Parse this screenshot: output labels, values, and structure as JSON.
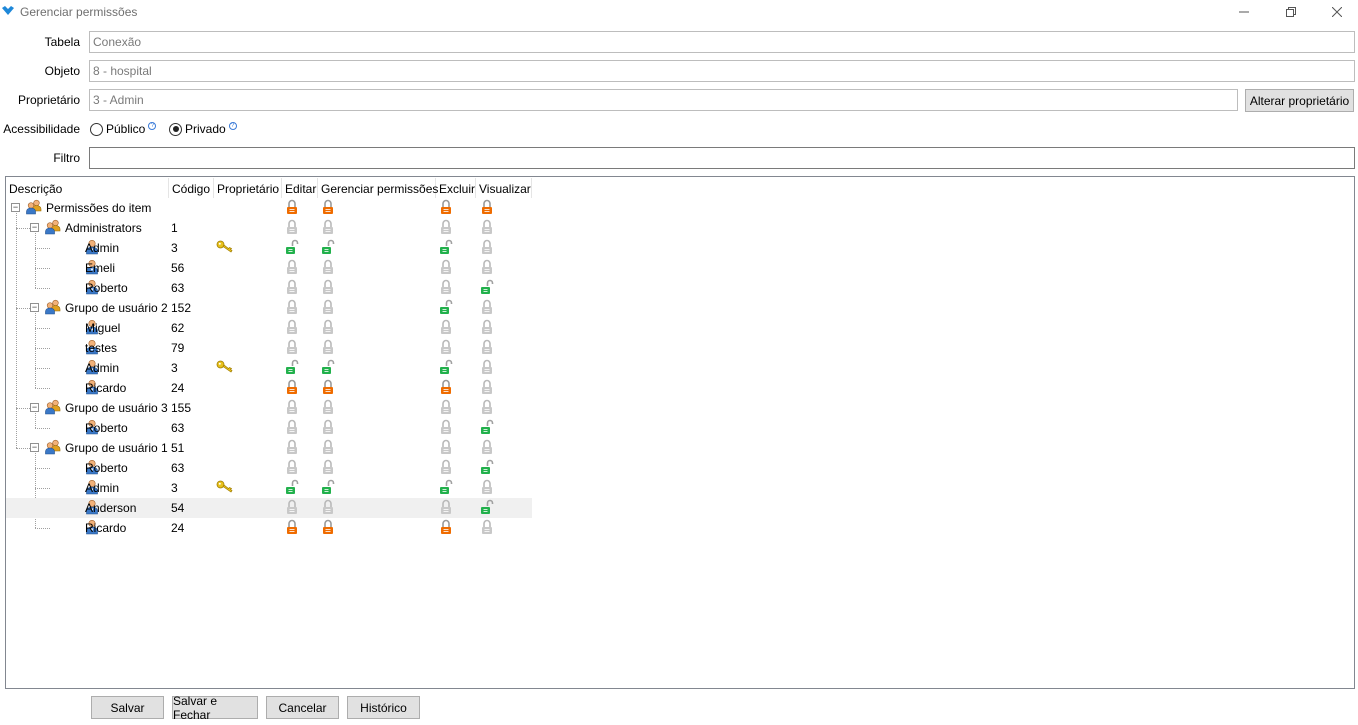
{
  "window": {
    "title": "Gerenciar permissões"
  },
  "form": {
    "tabela_label": "Tabela",
    "tabela_value": "Conexão",
    "objeto_label": "Objeto",
    "objeto_value": "8 - hospital",
    "proprietario_label": "Proprietário",
    "proprietario_value": "3 - Admin",
    "alterar_button": "Alterar proprietário",
    "acessibilidade_label": "Acessibilidade",
    "publico_label": "Público",
    "privado_label": "Privado",
    "selected_access": "Privado",
    "filtro_label": "Filtro",
    "filtro_value": ""
  },
  "columns": [
    "Descrição",
    "Código",
    "Proprietário",
    "Editar",
    "Gerenciar permissões",
    "Excluir",
    "Visualizar"
  ],
  "rows": [
    {
      "level": 0,
      "type": "group",
      "name": "Permissões do item",
      "code": "",
      "owner": false,
      "editar": "orange",
      "gerenciar": "orange",
      "excluir": "orange",
      "visualizar": "orange",
      "expanded": true
    },
    {
      "level": 1,
      "type": "group",
      "name": "Administrators",
      "code": "1",
      "owner": false,
      "editar": "gray",
      "gerenciar": "gray",
      "excluir": "gray",
      "visualizar": "gray",
      "expanded": true
    },
    {
      "level": 2,
      "type": "user",
      "name": "Admin",
      "code": "3",
      "owner": true,
      "editar": "green",
      "gerenciar": "green",
      "excluir": "green",
      "visualizar": "gray"
    },
    {
      "level": 2,
      "type": "user",
      "name": "Emeli",
      "code": "56",
      "owner": false,
      "editar": "gray",
      "gerenciar": "gray",
      "excluir": "gray",
      "visualizar": "gray"
    },
    {
      "level": 2,
      "type": "user",
      "name": "Roberto",
      "code": "63",
      "owner": false,
      "editar": "gray",
      "gerenciar": "gray",
      "excluir": "gray",
      "visualizar": "green"
    },
    {
      "level": 1,
      "type": "group",
      "name": "Grupo de usuário 2",
      "code": "152",
      "owner": false,
      "editar": "gray",
      "gerenciar": "gray",
      "excluir": "green",
      "visualizar": "gray",
      "expanded": true
    },
    {
      "level": 2,
      "type": "user",
      "name": "Miguel",
      "code": "62",
      "owner": false,
      "editar": "gray",
      "gerenciar": "gray",
      "excluir": "gray",
      "visualizar": "gray"
    },
    {
      "level": 2,
      "type": "user",
      "name": "testes",
      "code": "79",
      "owner": false,
      "editar": "gray",
      "gerenciar": "gray",
      "excluir": "gray",
      "visualizar": "gray"
    },
    {
      "level": 2,
      "type": "user",
      "name": "Admin",
      "code": "3",
      "owner": true,
      "editar": "green",
      "gerenciar": "green",
      "excluir": "green",
      "visualizar": "gray"
    },
    {
      "level": 2,
      "type": "user",
      "name": "Ricardo",
      "code": "24",
      "owner": false,
      "editar": "orange",
      "gerenciar": "orange",
      "excluir": "orange",
      "visualizar": "gray"
    },
    {
      "level": 1,
      "type": "group",
      "name": "Grupo de usuário 3",
      "code": "155",
      "owner": false,
      "editar": "gray",
      "gerenciar": "gray",
      "excluir": "gray",
      "visualizar": "gray",
      "expanded": true
    },
    {
      "level": 2,
      "type": "user",
      "name": "Roberto",
      "code": "63",
      "owner": false,
      "editar": "gray",
      "gerenciar": "gray",
      "excluir": "gray",
      "visualizar": "green"
    },
    {
      "level": 1,
      "type": "group",
      "name": "Grupo de usuário 1",
      "code": "51",
      "owner": false,
      "editar": "gray",
      "gerenciar": "gray",
      "excluir": "gray",
      "visualizar": "gray",
      "expanded": true
    },
    {
      "level": 2,
      "type": "user",
      "name": "Roberto",
      "code": "63",
      "owner": false,
      "editar": "gray",
      "gerenciar": "gray",
      "excluir": "gray",
      "visualizar": "green"
    },
    {
      "level": 2,
      "type": "user",
      "name": "Admin",
      "code": "3",
      "owner": true,
      "editar": "green",
      "gerenciar": "green",
      "excluir": "green",
      "visualizar": "gray"
    },
    {
      "level": 2,
      "type": "user",
      "name": "Anderson",
      "code": "54",
      "owner": false,
      "editar": "gray",
      "gerenciar": "gray",
      "excluir": "gray",
      "visualizar": "green",
      "selected": true
    },
    {
      "level": 2,
      "type": "user",
      "name": "Ricardo",
      "code": "24",
      "owner": false,
      "editar": "orange",
      "gerenciar": "orange",
      "excluir": "orange",
      "visualizar": "gray"
    }
  ],
  "buttons": {
    "salvar": "Salvar",
    "salvar_fechar": "Salvar e Fechar",
    "cancelar": "Cancelar",
    "historico": "Histórico"
  },
  "colors": {
    "lock_gray": "#c8c8c8",
    "lock_green": "#22b14c",
    "lock_orange": "#ef6c00",
    "key": "#e8c21c"
  }
}
